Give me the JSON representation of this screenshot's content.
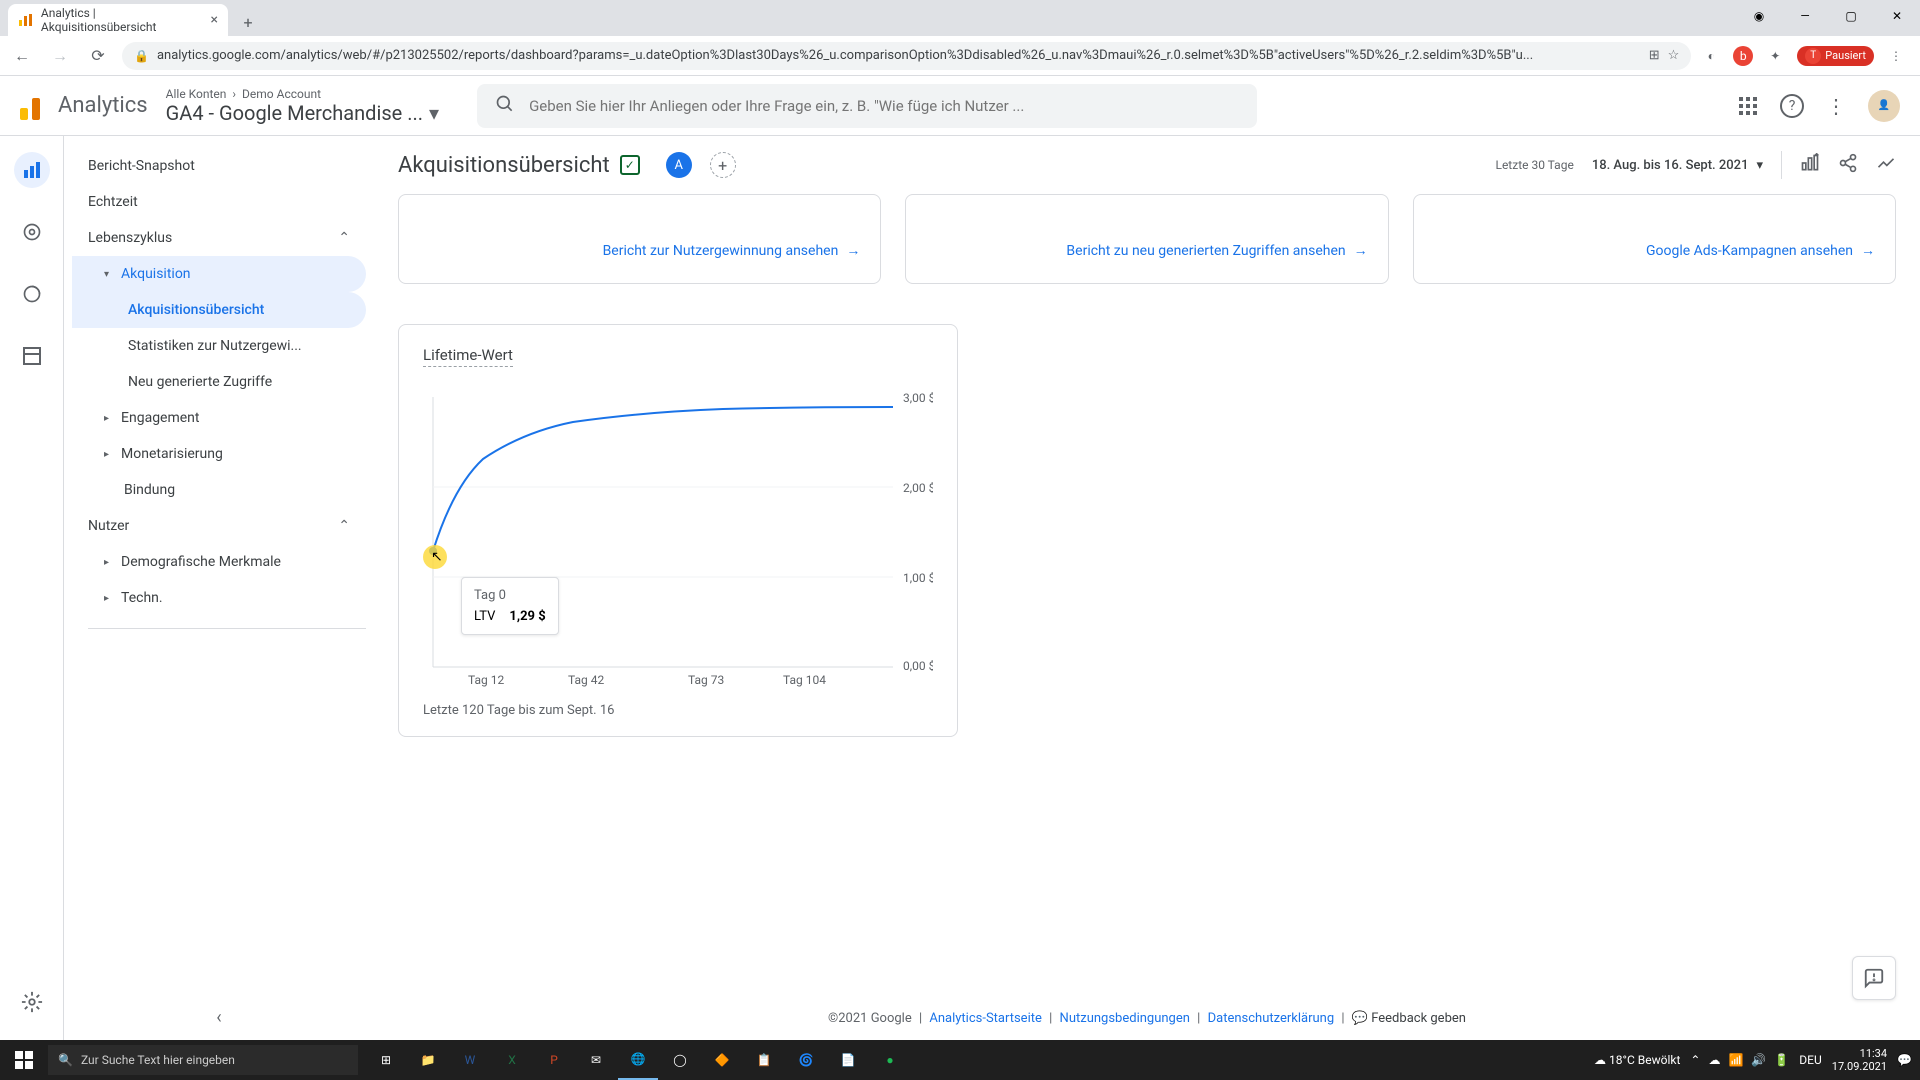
{
  "browser": {
    "tab_title": "Analytics | Akquisitionsübersicht",
    "url": "analytics.google.com/analytics/web/#/p213025502/reports/dashboard?params=_u.dateOption%3Dlast30Days%26_u.comparisonOption%3Ddisabled%26_u.nav%3Dmaui%26_r.0.selmet%3D%5B\"activeUsers\"%5D%26_r.2.seldim%3D%5B\"u...",
    "profile_status": "Pausiert"
  },
  "header": {
    "product": "Analytics",
    "breadcrumb_all": "Alle Konten",
    "breadcrumb_account": "Demo Account",
    "property": "GA4 - Google Merchandise ...",
    "search_placeholder": "Geben Sie hier Ihr Anliegen oder Ihre Frage ein, z. B. \"Wie füge ich Nutzer ..."
  },
  "sidebar": {
    "snapshot": "Bericht-Snapshot",
    "realtime": "Echtzeit",
    "lifecycle": "Lebenszyklus",
    "acquisition": "Akquisition",
    "acq_overview": "Akquisitionsübersicht",
    "acq_user": "Statistiken zur Nutzergewi...",
    "acq_traffic": "Neu generierte Zugriffe",
    "engagement": "Engagement",
    "monetization": "Monetarisierung",
    "retention": "Bindung",
    "user_section": "Nutzer",
    "demographics": "Demografische Merkmale",
    "tech": "Techn."
  },
  "report": {
    "title": "Akquisitionsübersicht",
    "badge": "A",
    "date_label": "Letzte 30 Tage",
    "date_range": "18. Aug. bis 16. Sept. 2021"
  },
  "cards": {
    "link1": "Bericht zur Nutzergewinnung ansehen",
    "link2": "Bericht zu neu generierten Zugriffen ansehen",
    "link3": "Google Ads-Kampagnen ansehen"
  },
  "ltv": {
    "title": "Lifetime-Wert",
    "caption": "Letzte 120 Tage bis zum Sept. 16",
    "tooltip_title": "Tag 0",
    "tooltip_label": "LTV",
    "tooltip_value": "1,29 $",
    "y_labels": [
      "3,00 $",
      "2,00 $",
      "1,00 $",
      "0,00 $"
    ],
    "x_labels": [
      "Tag 12",
      "Tag 42",
      "Tag 73",
      "Tag 104"
    ]
  },
  "chart_data": {
    "type": "line",
    "title": "Lifetime-Wert",
    "xlabel": "Tag",
    "ylabel": "$",
    "ylim": [
      0,
      3
    ],
    "x": [
      0,
      12,
      24,
      36,
      42,
      50,
      60,
      73,
      85,
      104,
      120
    ],
    "values": [
      1.29,
      2.1,
      2.45,
      2.62,
      2.66,
      2.72,
      2.76,
      2.78,
      2.79,
      2.8,
      2.8
    ]
  },
  "footer": {
    "copyright": "©2021 Google",
    "home": "Analytics-Startseite",
    "terms": "Nutzungsbedingungen",
    "privacy": "Datenschutzerklärung",
    "feedback": "Feedback geben"
  },
  "taskbar": {
    "search_placeholder": "Zur Suche Text hier eingeben",
    "weather": "18°C  Bewölkt",
    "time": "11:34",
    "date": "17.09.2021",
    "lang": "DEU"
  }
}
